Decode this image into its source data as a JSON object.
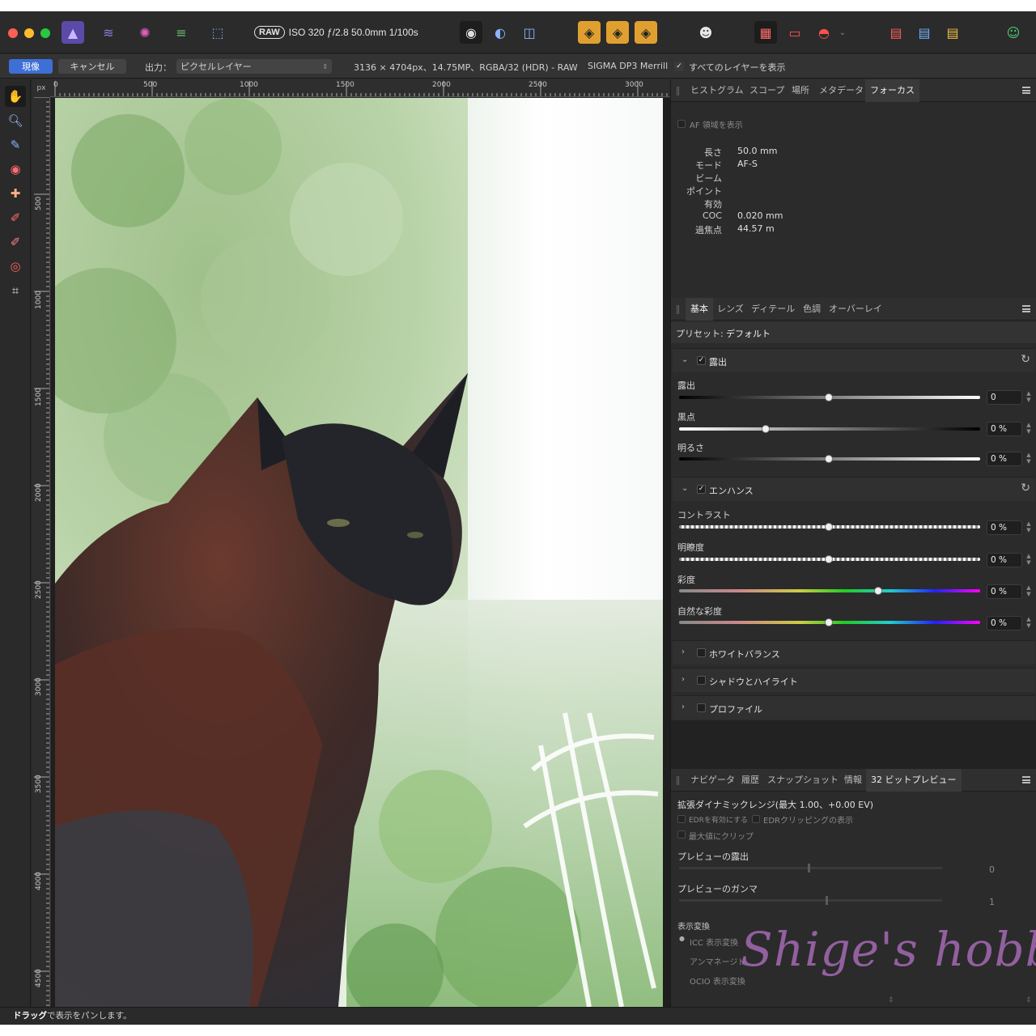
{
  "window": {
    "exif": {
      "raw_badge": "RAW",
      "text": "ISO 320 ƒ/2.8 50.0mm 1/100s"
    }
  },
  "context_bar": {
    "develop_button": "現像",
    "cancel_button": "キャンセル",
    "output_label": "出力：",
    "output_value": "ピクセルレイヤー",
    "image_info": "3136 × 4704px、14.75MP、RGBA/32 (HDR) - RAW",
    "camera": "SIGMA DP3 Merrill",
    "show_all_layers_label": "すべてのレイヤーを表示"
  },
  "ruler": {
    "unit": "px",
    "top_labels": [
      "0",
      "500",
      "1000",
      "1500",
      "2000",
      "2500",
      "3000"
    ],
    "left_labels": [
      "500",
      "1000",
      "1500",
      "2000",
      "2500",
      "3000",
      "3500",
      "4000",
      "4500"
    ]
  },
  "focus_panel": {
    "tabs": [
      "ヒストグラム",
      "スコープ",
      "場所",
      "メタデータ",
      "フォーカス"
    ],
    "active_tab": "フォーカス",
    "af_area_label": "AF 領域を表示",
    "rows": [
      {
        "key": "長さ",
        "value": "50.0 mm"
      },
      {
        "key": "モード",
        "value": "AF-S"
      },
      {
        "key": "ビーム",
        "value": ""
      },
      {
        "key": "ポイント",
        "value": ""
      },
      {
        "key": "有効",
        "value": ""
      },
      {
        "key": "COC",
        "value": "0.020 mm"
      },
      {
        "key": "過焦点",
        "value": "44.57 m"
      }
    ]
  },
  "develop_panel": {
    "tabs": [
      "基本",
      "レンズ",
      "ディテール",
      "色調",
      "オーバーレイ"
    ],
    "active_tab": "基本",
    "preset_label": "プリセット:",
    "preset_value": "デフォルト",
    "exposure_section": {
      "title": "露出",
      "sliders": [
        {
          "label": "露出",
          "value": "0",
          "position": 0.5
        },
        {
          "label": "黒点",
          "value": "0 %",
          "position": 0.29
        },
        {
          "label": "明るさ",
          "value": "0 %",
          "position": 0.5
        }
      ]
    },
    "enhance_section": {
      "title": "エンハンス",
      "sliders": [
        {
          "label": "コントラスト",
          "value": "0 %",
          "position": 0.5
        },
        {
          "label": "明瞭度",
          "value": "0 %",
          "position": 0.5
        },
        {
          "label": "彩度",
          "value": "0 %",
          "position": 0.665
        },
        {
          "label": "自然な彩度",
          "value": "0 %",
          "position": 0.5
        }
      ]
    },
    "collapsed_sections": [
      "ホワイトバランス",
      "シャドウとハイライト",
      "プロファイル"
    ]
  },
  "preview_panel": {
    "tabs": [
      "ナビゲータ",
      "履歴",
      "スナップショット",
      "情報",
      "32 ビットプレビュー"
    ],
    "active_tab": "32 ビットプレビュー",
    "edr_title": "拡張ダイナミックレンジ(最大 1.00、+0.00 EV)",
    "enable_edr": "EDRを有効にする",
    "show_edr_clipping": "EDRクリッピングの表示",
    "clip_to_max": "最大値にクリップ",
    "preview_exposure_label": "プレビューの露出",
    "preview_exposure_value": "0",
    "preview_gamma_label": "プレビューのガンマ",
    "preview_gamma_value": "1",
    "display_transform_label": "表示変換",
    "icc_option": "ICC 表示変換",
    "unmanaged_option": "アンマネージド",
    "ocio_option": "OCIO 表示変換"
  },
  "status_bar": {
    "bold": "ドラッグ",
    "text": "で表示をパンします。"
  },
  "watermark": "Shige's hobby",
  "colors": {
    "accent_blue": "#3d6fd6",
    "slider_green_yellow": "#2e8b57",
    "watermark": "#b070c0"
  }
}
